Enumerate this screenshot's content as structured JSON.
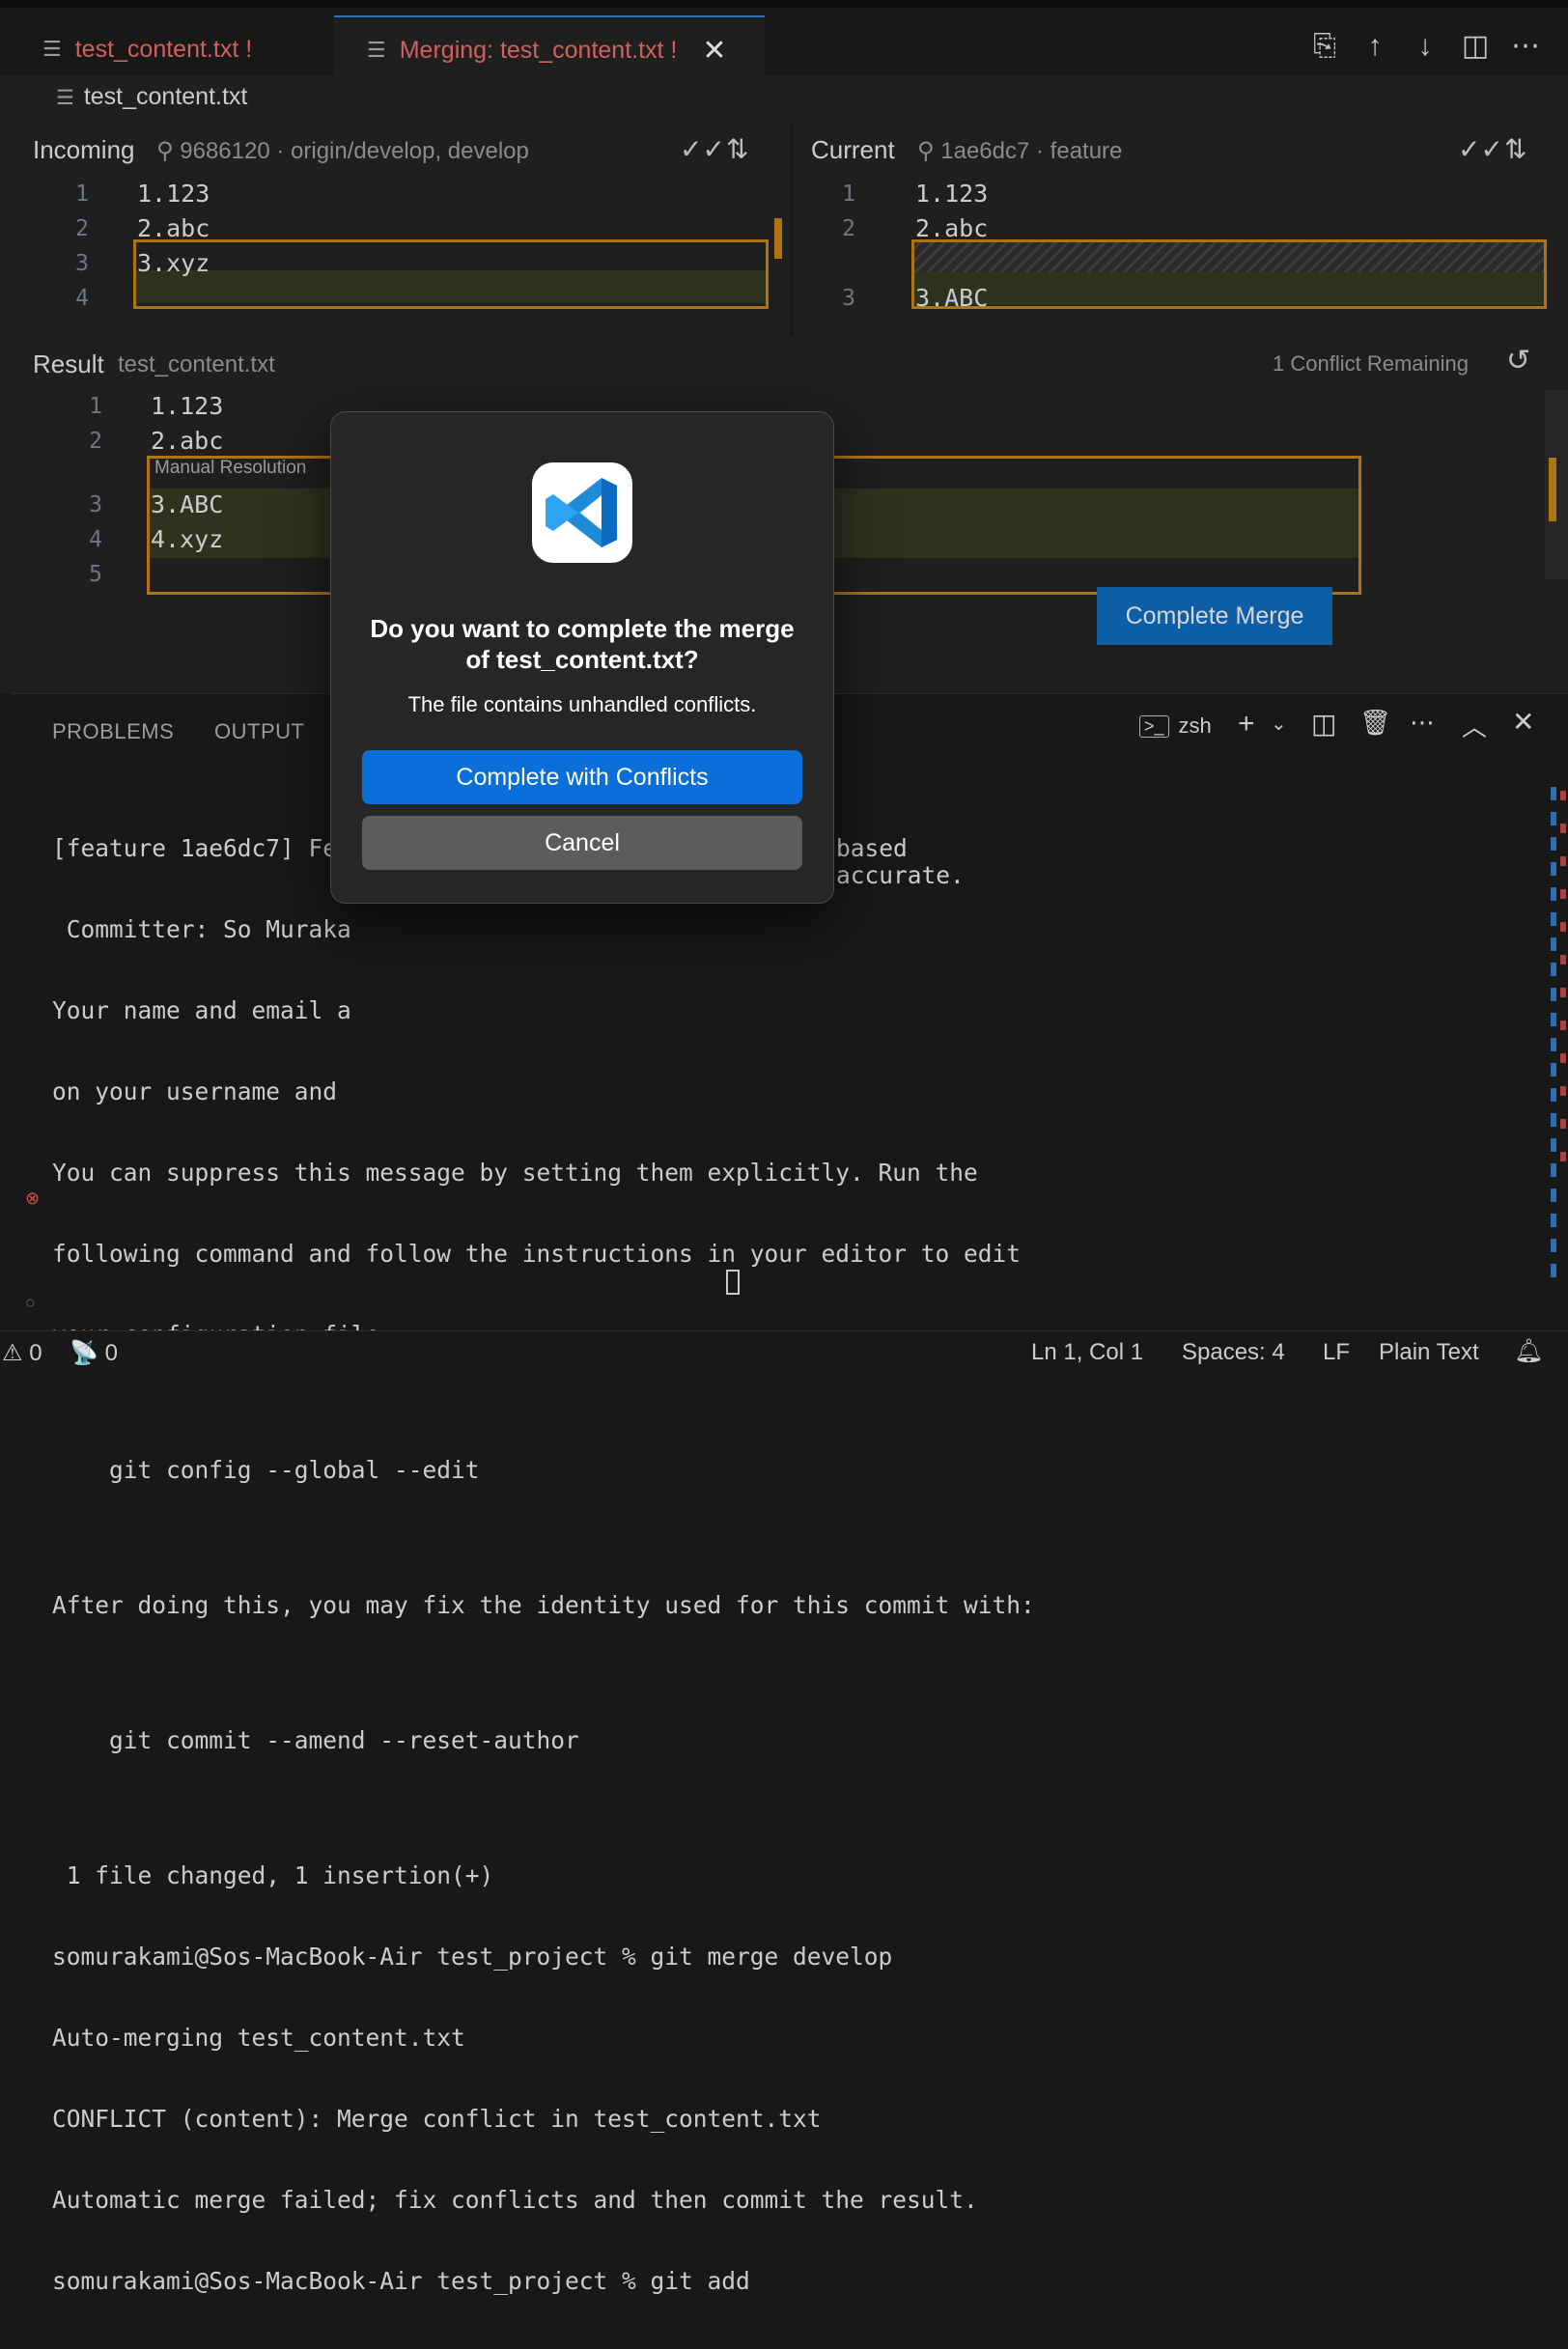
{
  "tabs": [
    {
      "label": "test_content.txt !"
    },
    {
      "label": "Merging: test_content.txt !"
    }
  ],
  "breadcrumb": {
    "file": "test_content.txt"
  },
  "incoming": {
    "label": "Incoming",
    "commit": "9686120",
    "refs": "origin/develop, develop",
    "lines": [
      {
        "num": "1",
        "text": "1.123"
      },
      {
        "num": "2",
        "text": "2.abc"
      },
      {
        "num": "3",
        "text": "3.xyz"
      },
      {
        "num": "4",
        "text": ""
      }
    ]
  },
  "current": {
    "label": "Current",
    "commit": "1ae6dc7",
    "refs": "feature",
    "lines": [
      {
        "num": "1",
        "text": "1.123"
      },
      {
        "num": "2",
        "text": "2.abc"
      },
      {
        "num": "3",
        "text": "3.ABC"
      }
    ]
  },
  "result": {
    "label": "Result",
    "file": "test_content.txt",
    "conflicts_remaining": "1 Conflict Remaining",
    "manual_resolution": "Manual Resolution",
    "lines": [
      {
        "num": "1",
        "text": "1.123"
      },
      {
        "num": "2",
        "text": "2.abc"
      },
      {
        "num": "3",
        "text": "3.ABC"
      },
      {
        "num": "4",
        "text": "4.xyz"
      },
      {
        "num": "5",
        "text": ""
      }
    ],
    "complete_merge": "Complete Merge"
  },
  "panel": {
    "tabs": [
      "PROBLEMS",
      "OUTPUT"
    ],
    "terminal_name": "zsh",
    "terminal_lines": [
      "[feature 1ae6dc7] Fea",
      " Committer: So Muraka",
      "Your name and email a",
      "on your username and",
      "You can suppress this message by setting them explicitly. Run the",
      "following command and follow the instructions in your editor to edit",
      "your configuration file:",
      "",
      "    git config --global --edit",
      "",
      "After doing this, you may fix the identity used for this commit with:",
      "",
      "    git commit --amend --reset-author",
      "",
      " 1 file changed, 1 insertion(+)",
      "somurakami@Sos-MacBook-Air test_project % git merge develop",
      "Auto-merging test_content.txt",
      "CONFLICT (content): Merge conflict in test_content.txt",
      "Automatic merge failed; fix conflicts and then commit the result.",
      "somurakami@Sos-MacBook-Air test_project % git add "
    ],
    "terminal_tail_right": [
      "based",
      "accurate."
    ]
  },
  "status": {
    "warnings": "0",
    "ports": "0",
    "position": "Ln 1, Col 1",
    "spaces": "Spaces: 4",
    "eol": "LF",
    "language": "Plain Text"
  },
  "dialog": {
    "title": "Do you want to complete the merge of test_content.txt?",
    "message": "The file contains unhandled conflicts.",
    "primary_button": "Complete with Conflicts",
    "cancel_button": "Cancel"
  },
  "colors": {
    "conflict_border": "#b07314",
    "button_primary": "#0a6fd9",
    "tab_modified": "#d2605d",
    "vscode_blue": "#1f8ad6"
  }
}
